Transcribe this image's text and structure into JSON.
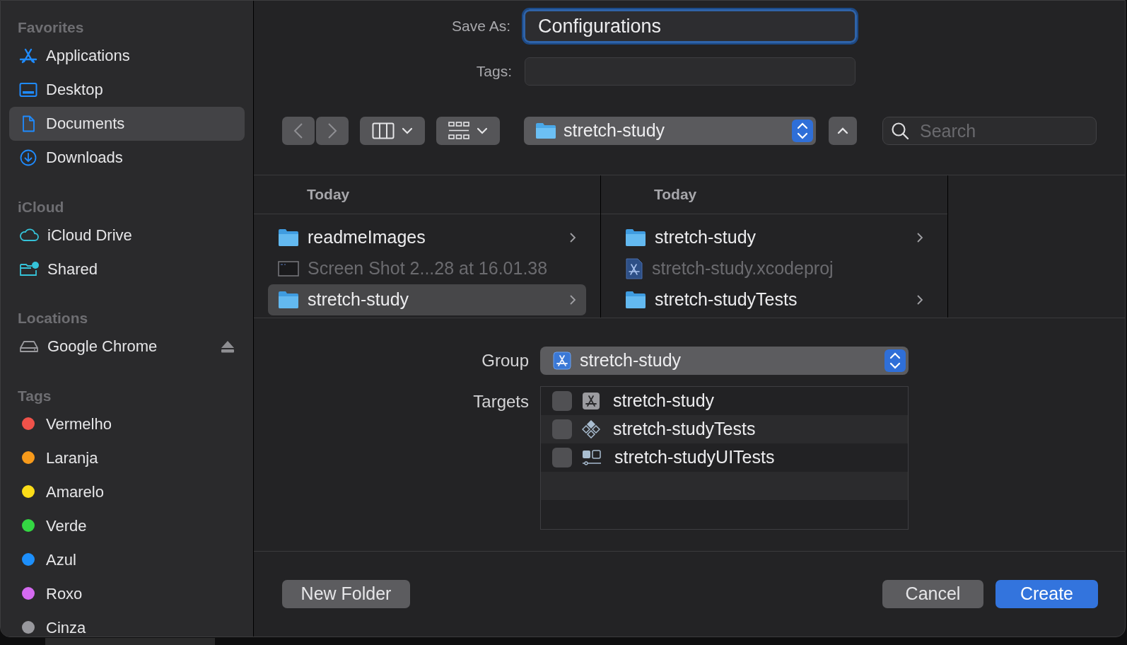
{
  "sidebar": {
    "sections": [
      {
        "header": "Favorites",
        "items": [
          {
            "label": "Applications",
            "kind": "apps",
            "selected": false
          },
          {
            "label": "Desktop",
            "kind": "desktop",
            "selected": false
          },
          {
            "label": "Documents",
            "kind": "document",
            "selected": true
          },
          {
            "label": "Downloads",
            "kind": "download",
            "selected": false
          }
        ]
      },
      {
        "header": "iCloud",
        "items": [
          {
            "label": "iCloud Drive",
            "kind": "cloud",
            "selected": false
          },
          {
            "label": "Shared",
            "kind": "shared",
            "selected": false
          }
        ]
      },
      {
        "header": "Locations",
        "items": [
          {
            "label": "Google Chrome",
            "kind": "drive",
            "selected": false,
            "ejectable": true
          }
        ]
      },
      {
        "header": "Tags",
        "items": [
          {
            "label": "Vermelho",
            "kind": "tag",
            "color": "#f0524a",
            "selected": false
          },
          {
            "label": "Laranja",
            "kind": "tag",
            "color": "#f79a1b",
            "selected": false
          },
          {
            "label": "Amarelo",
            "kind": "tag",
            "color": "#fcdd18",
            "selected": false
          },
          {
            "label": "Verde",
            "kind": "tag",
            "color": "#34d743",
            "selected": false
          },
          {
            "label": "Azul",
            "kind": "tag",
            "color": "#1d8ffb",
            "selected": false
          },
          {
            "label": "Roxo",
            "kind": "tag",
            "color": "#d46af0",
            "selected": false
          },
          {
            "label": "Cinza",
            "kind": "tag",
            "color": "#98989d",
            "selected": false
          }
        ]
      }
    ]
  },
  "save_as": {
    "label": "Save As:",
    "value": "Configurations"
  },
  "tags_field": {
    "label": "Tags:"
  },
  "toolbar": {
    "path": "stretch-study",
    "search": {
      "placeholder": "Search"
    }
  },
  "browser": {
    "columns": [
      {
        "header": "Today",
        "rows": [
          {
            "name": "readmeImages",
            "kind": "folder",
            "disabled": false,
            "selected": false,
            "has_children": true
          },
          {
            "name": "Screen Shot 2...28 at 16.01.38",
            "kind": "screenshot",
            "disabled": true,
            "selected": false,
            "has_children": false
          },
          {
            "name": "stretch-study",
            "kind": "folder",
            "disabled": false,
            "selected": true,
            "has_children": true
          }
        ]
      },
      {
        "header": "Today",
        "rows": [
          {
            "name": "stretch-study",
            "kind": "folder",
            "disabled": false,
            "selected": false,
            "has_children": true
          },
          {
            "name": "stretch-study.xcodeproj",
            "kind": "project",
            "disabled": true,
            "selected": false,
            "has_children": false
          },
          {
            "name": "stretch-studyTests",
            "kind": "folder",
            "disabled": false,
            "selected": false,
            "has_children": true
          }
        ]
      }
    ]
  },
  "group": {
    "label": "Group",
    "value": "stretch-study"
  },
  "targets": {
    "label": "Targets",
    "items": [
      {
        "name": "stretch-study",
        "kind": "app",
        "checked": false
      },
      {
        "name": "stretch-studyTests",
        "kind": "unit",
        "checked": false
      },
      {
        "name": "stretch-studyUITests",
        "kind": "ui",
        "checked": false
      }
    ]
  },
  "buttons": [
    {
      "label": "New Folder",
      "kind": "secondary"
    },
    {
      "label": "Cancel",
      "kind": "secondary"
    },
    {
      "label": "Create",
      "kind": "default"
    }
  ]
}
